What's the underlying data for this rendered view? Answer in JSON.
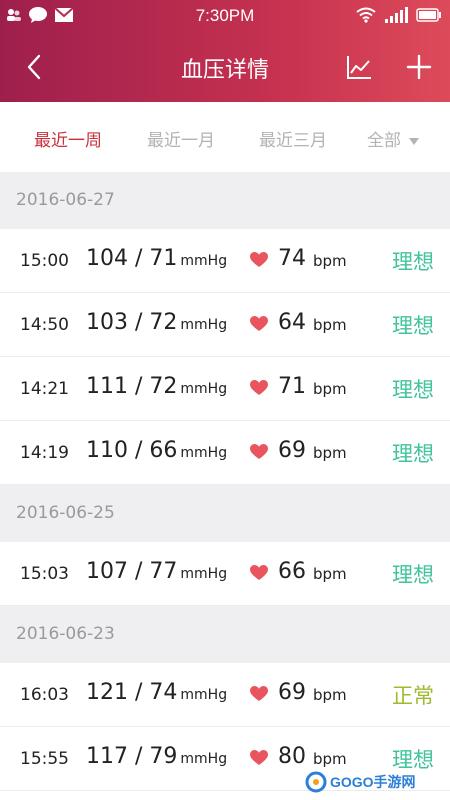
{
  "status_bar": {
    "time": "7:30PM"
  },
  "navbar": {
    "title": "血压详情"
  },
  "tabs": [
    {
      "label": "最近一周",
      "active": true
    },
    {
      "label": "最近一月",
      "active": false
    },
    {
      "label": "最近三月",
      "active": false
    },
    {
      "label": "全部",
      "active": false
    }
  ],
  "groups": [
    {
      "date": "2016-06-27",
      "readings": [
        {
          "time": "15:00",
          "bp": "104 / 71",
          "unit": "mmHg",
          "pulse": "74",
          "pulse_unit": "bpm",
          "status": "理想"
        },
        {
          "time": "14:50",
          "bp": "103 / 72",
          "unit": "mmHg",
          "pulse": "64",
          "pulse_unit": "bpm",
          "status": "理想"
        },
        {
          "time": "14:21",
          "bp": "111 / 72",
          "unit": "mmHg",
          "pulse": "71",
          "pulse_unit": "bpm",
          "status": "理想"
        },
        {
          "time": "14:19",
          "bp": "110 / 66",
          "unit": "mmHg",
          "pulse": "69",
          "pulse_unit": "bpm",
          "status": "理想"
        }
      ]
    },
    {
      "date": "2016-06-25",
      "readings": [
        {
          "time": "15:03",
          "bp": "107 / 77",
          "unit": "mmHg",
          "pulse": "66",
          "pulse_unit": "bpm",
          "status": "理想"
        }
      ]
    },
    {
      "date": "2016-06-23",
      "readings": [
        {
          "time": "16:03",
          "bp": "121 / 74",
          "unit": "mmHg",
          "pulse": "69",
          "pulse_unit": "bpm",
          "status": "正常"
        },
        {
          "time": "15:55",
          "bp": "117 / 79",
          "unit": "mmHg",
          "pulse": "80",
          "pulse_unit": "bpm",
          "status": "理想"
        }
      ]
    }
  ],
  "watermark": {
    "text": "GOGO手游网"
  },
  "colors": {
    "accent": "#c8323d",
    "ideal": "#41c39b",
    "normal": "#9dba31",
    "header_from": "#9e1f4d",
    "header_to": "#dd4b5a"
  }
}
